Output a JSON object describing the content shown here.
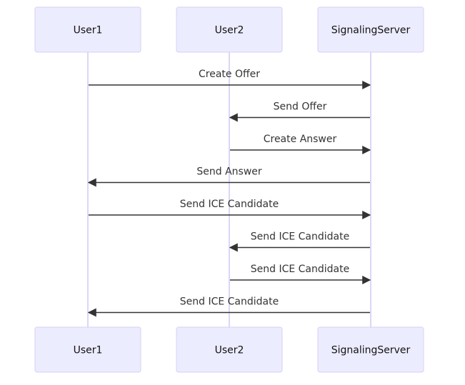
{
  "diagram": {
    "type": "sequence",
    "actors": [
      {
        "id": "user1",
        "label": "User1"
      },
      {
        "id": "user2",
        "label": "User2"
      },
      {
        "id": "server",
        "label": "SignalingServer"
      }
    ],
    "messages": [
      {
        "from": "user1",
        "to": "server",
        "label": "Create Offer"
      },
      {
        "from": "server",
        "to": "user2",
        "label": "Send Offer"
      },
      {
        "from": "user2",
        "to": "server",
        "label": "Create Answer"
      },
      {
        "from": "server",
        "to": "user1",
        "label": "Send Answer"
      },
      {
        "from": "user1",
        "to": "server",
        "label": "Send ICE Candidate"
      },
      {
        "from": "server",
        "to": "user2",
        "label": "Send ICE Candidate"
      },
      {
        "from": "user2",
        "to": "server",
        "label": "Send ICE Candidate"
      },
      {
        "from": "server",
        "to": "user1",
        "label": "Send ICE Candidate"
      }
    ],
    "colors": {
      "actor_fill": "#ECECFF",
      "actor_border": "#D6D0F5",
      "lifeline": "#D2C9F2",
      "message": "#333333"
    }
  }
}
